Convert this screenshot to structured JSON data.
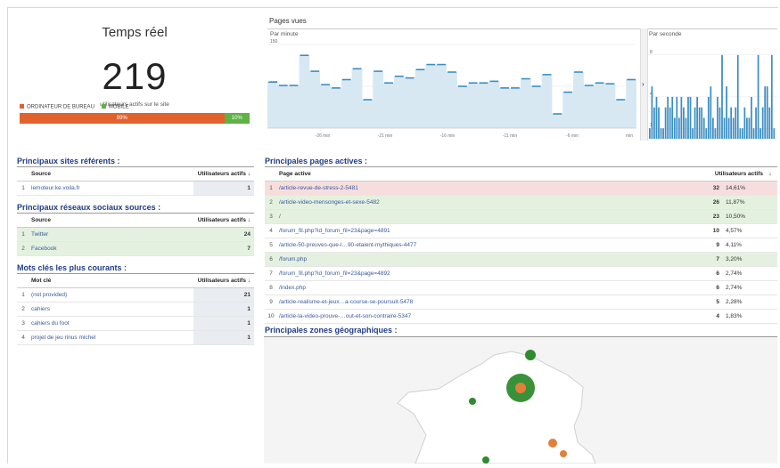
{
  "realtime": {
    "title": "Temps réel",
    "count": "219",
    "subtitle": "utilisateurs actifs sur le site",
    "legend_desktop": "ORDINATEUR DE BUREAU",
    "legend_mobile": "MOBILE",
    "desktop_pct": "89%",
    "mobile_pct": "10%",
    "desktop_color": "#e2622d",
    "mobile_color": "#5fb245"
  },
  "pageviews": {
    "title": "Pages vues",
    "per_minute_label": "Par minute",
    "per_second_label": "Par seconde",
    "arrow": "›"
  },
  "chart_data": [
    {
      "type": "line",
      "title": "Par minute",
      "ylim": [
        50,
        150
      ],
      "ytick_labels": [
        "150",
        "100",
        "50"
      ],
      "xtick_labels": [
        "-26 min",
        "-21 min",
        "-16 min",
        "-11 min",
        "-6 min",
        "min"
      ],
      "values": [
        105,
        101,
        101,
        137,
        118,
        102,
        98,
        108,
        121,
        84,
        118,
        104,
        112,
        110,
        120,
        126,
        126,
        117,
        100,
        104,
        104,
        106,
        98,
        98,
        109,
        100,
        114,
        67,
        93,
        117,
        101,
        104,
        103,
        84,
        108
      ]
    },
    {
      "type": "bar",
      "title": "Par seconde",
      "ylim": [
        0,
        9
      ],
      "ytick_labels": [
        "8",
        "4",
        "1"
      ],
      "values": [
        1,
        5,
        3,
        4,
        3,
        1,
        1,
        3,
        4,
        3,
        4,
        2,
        4,
        2,
        4,
        3,
        2,
        4,
        4,
        1,
        3,
        4,
        3,
        3,
        2,
        1,
        4,
        5,
        2,
        1,
        4,
        3,
        8,
        2,
        5,
        2,
        3,
        2,
        3,
        8,
        1,
        1,
        3,
        2,
        2,
        4,
        1,
        3,
        8,
        1,
        3,
        5,
        5,
        3,
        8,
        1
      ]
    }
  ],
  "referrers": {
    "title": "Principaux sites référents :",
    "col_source": "Source",
    "col_users": "Utilisateurs actifs ↓",
    "rows": [
      {
        "idx": "1",
        "label": "lemoteur.ke.voila.fr",
        "value": "1"
      }
    ]
  },
  "social": {
    "title": "Principaux réseaux sociaux sources :",
    "col_source": "Source",
    "col_users": "Utilisateurs actifs ↓",
    "rows": [
      {
        "idx": "1",
        "label": "Twitter",
        "value": "24"
      },
      {
        "idx": "2",
        "label": "Facebook",
        "value": "7"
      }
    ]
  },
  "keywords": {
    "title": "Mots clés les plus courants :",
    "col_kw": "Mot clé",
    "col_users": "Utilisateurs actifs ↓",
    "rows": [
      {
        "idx": "1",
        "label": "(not provided)",
        "value": "21"
      },
      {
        "idx": "2",
        "label": "cahiers",
        "value": "1"
      },
      {
        "idx": "3",
        "label": "cahiers du foot",
        "value": "1"
      },
      {
        "idx": "4",
        "label": "projet de jeu rinus michel",
        "value": "1"
      }
    ]
  },
  "pages": {
    "title": "Principales pages actives :",
    "col_page": "Page active",
    "col_users": "Utilisateurs actifs",
    "sort_arrow": "↓",
    "rows": [
      {
        "idx": "1",
        "label": "/article-revue-de-stress-2-5481",
        "value": "32",
        "pct": "14,61%"
      },
      {
        "idx": "2",
        "label": "/article-video-mensonges-et-sexe-5482",
        "value": "26",
        "pct": "11,87%"
      },
      {
        "idx": "3",
        "label": "/",
        "value": "23",
        "pct": "10,50%"
      },
      {
        "idx": "4",
        "label": "/forum_fil.php?id_forum_fil=23&page=4891",
        "value": "10",
        "pct": "4,57%"
      },
      {
        "idx": "5",
        "label": "/article-50-preuves-que-l…90-etaient-mythiques-4477",
        "value": "9",
        "pct": "4,11%"
      },
      {
        "idx": "6",
        "label": "/forum.php",
        "value": "7",
        "pct": "3,20%"
      },
      {
        "idx": "7",
        "label": "/forum_fil.php?id_forum_fil=23&page=4892",
        "value": "6",
        "pct": "2,74%"
      },
      {
        "idx": "8",
        "label": "/index.php",
        "value": "6",
        "pct": "2,74%"
      },
      {
        "idx": "9",
        "label": "/article-realisme-et-jeux…a-course-se-poursuit-5478",
        "value": "5",
        "pct": "2,28%"
      },
      {
        "idx": "10",
        "label": "/article-la-video-prouve-…out-et-son-contraire-5347",
        "value": "4",
        "pct": "1,83%"
      }
    ]
  },
  "geo": {
    "title": "Principales zones géographiques :",
    "marker_green": "#2e8b2e",
    "marker_orange": "#e0803a"
  }
}
